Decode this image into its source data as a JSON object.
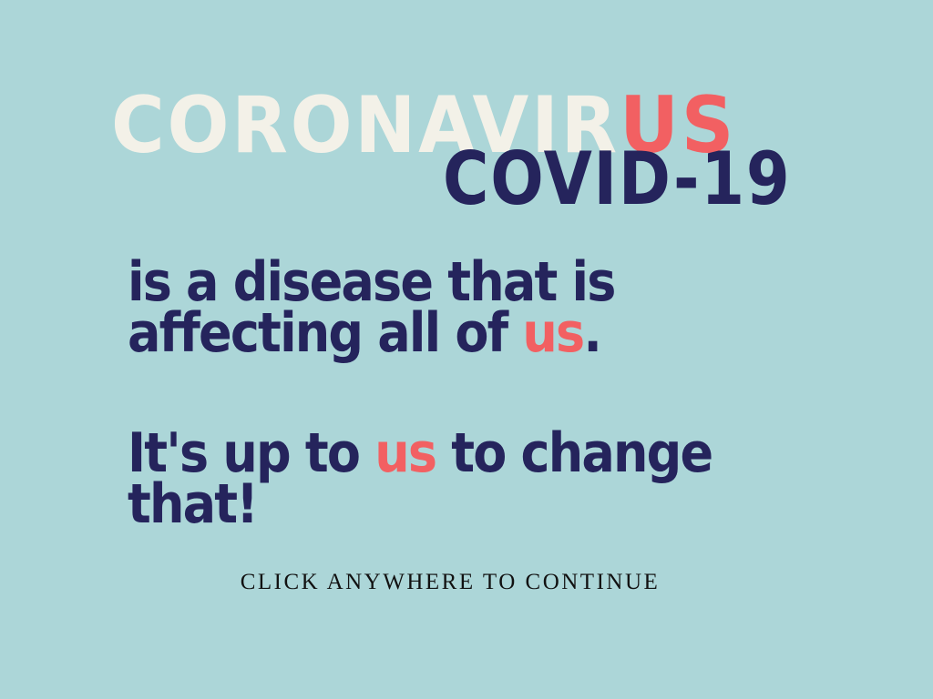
{
  "heading": {
    "part1": "CORONAVIR",
    "part2": "US",
    "subtitle": "COVID-19"
  },
  "message": {
    "line1": "is a disease that is",
    "line2_prefix": "affecting all of ",
    "line2_accent": "us",
    "line2_suffix": ".",
    "line3_prefix": "It's up to ",
    "line3_accent": "us",
    "line3_suffix": " to change",
    "line4": "that!"
  },
  "cta": {
    "label": "CLICK ANYWHERE TO CONTINUE"
  },
  "colors": {
    "background": "#acd6d8",
    "cream": "#f3f1e8",
    "accent": "#f26062",
    "navy": "#25245c",
    "cta": "#111111"
  }
}
